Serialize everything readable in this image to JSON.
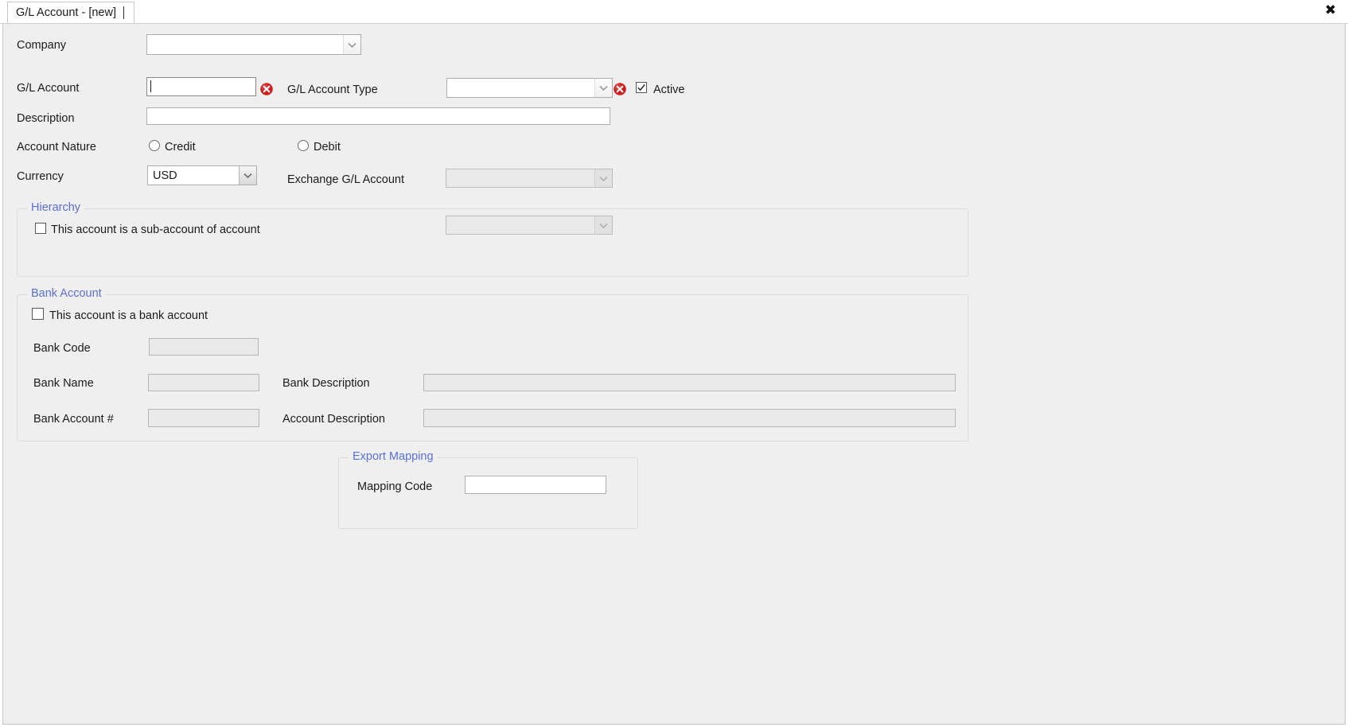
{
  "window": {
    "tab_label": "G/L Account - [new]",
    "close_icon": "close-icon",
    "close_glyph": "✖"
  },
  "form": {
    "company": {
      "label": "Company",
      "value": "",
      "placeholder": ""
    },
    "gl_account": {
      "label": "G/L Account",
      "value": "",
      "placeholder": "",
      "error_icon": "error-icon"
    },
    "gl_account_type": {
      "label": "G/L Account Type",
      "value": "",
      "error_icon": "error-icon"
    },
    "active": {
      "label": "Active",
      "checked": true
    },
    "description": {
      "label": "Description",
      "value": "",
      "placeholder": ""
    },
    "account_nature": {
      "label": "Account Nature",
      "options": [
        {
          "label": "Credit",
          "selected": false
        },
        {
          "label": "Debit",
          "selected": false
        }
      ]
    },
    "currency": {
      "label": "Currency",
      "value": "USD"
    },
    "exchange_gl_account": {
      "label": "Exchange G/L Account",
      "value": "",
      "enabled": false
    },
    "hierarchy": {
      "title": "Hierarchy",
      "sub_account_checkbox": {
        "label": "This account is a sub-account of account",
        "checked": false
      },
      "parent_account": {
        "value": "",
        "enabled": false
      }
    },
    "bank_account": {
      "title": "Bank Account",
      "is_bank_account_checkbox": {
        "label": "This account is a bank account",
        "checked": false
      },
      "bank_code": {
        "label": "Bank Code",
        "value": "",
        "enabled": false
      },
      "bank_name": {
        "label": "Bank Name",
        "value": "",
        "enabled": false
      },
      "bank_description": {
        "label": "Bank Description",
        "value": "",
        "enabled": false
      },
      "bank_account_number": {
        "label": "Bank Account #",
        "value": "",
        "enabled": false
      },
      "account_description": {
        "label": "Account Description",
        "value": "",
        "enabled": false
      }
    },
    "export_mapping": {
      "title": "Export Mapping",
      "mapping_code": {
        "label": "Mapping Code",
        "value": "",
        "enabled": true
      }
    }
  },
  "colors": {
    "form_background": "#efefef",
    "group_title": "#5b6fd4",
    "error_red": "#cc1f1f",
    "text": "#1b1b1b",
    "field_border": "#aeaeae",
    "disabled_field": "#e9e9e9"
  }
}
